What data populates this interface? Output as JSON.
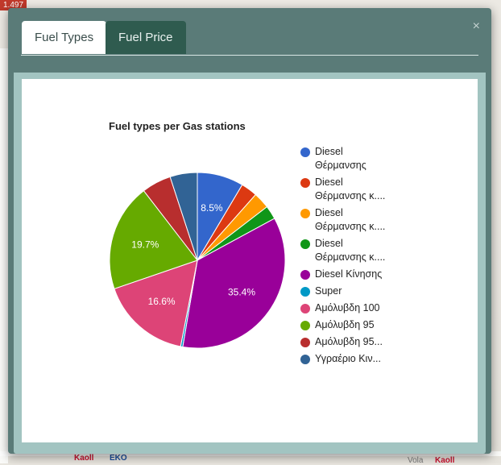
{
  "background": {
    "badge": "1.497",
    "logos": [
      "Kaoll",
      "EKO",
      "Kaoll",
      "Vola"
    ]
  },
  "modal": {
    "tabs": [
      {
        "label": "Fuel Types",
        "active": true
      },
      {
        "label": "Fuel Price",
        "active": false
      }
    ],
    "close_symbol": "×"
  },
  "chart_data": {
    "type": "pie",
    "title": "Fuel types per Gas stations",
    "legend_position": "right",
    "series": [
      {
        "name": "Diesel Θέρμανσης",
        "legend_lines": [
          "Diesel",
          "Θέρμανσης"
        ],
        "value": 8.5,
        "color": "#3366cc",
        "label": "8.5%"
      },
      {
        "name": "Diesel Θέρμανσης κ....",
        "legend_lines": [
          "Diesel",
          "Θέρμανσης κ...."
        ],
        "value": 3.0,
        "color": "#dc3912",
        "label": ""
      },
      {
        "name": "Diesel Θέρμανσης κ....",
        "legend_lines": [
          "Diesel",
          "Θέρμανσης κ...."
        ],
        "value": 3.0,
        "color": "#ff9900",
        "label": ""
      },
      {
        "name": "Diesel Θέρμανσης κ....",
        "legend_lines": [
          "Diesel",
          "Θέρμανσης κ...."
        ],
        "value": 2.5,
        "color": "#109618",
        "label": ""
      },
      {
        "name": "Diesel Κίνησης",
        "legend_lines": [
          "Diesel Κίνησης"
        ],
        "value": 35.4,
        "color": "#990099",
        "label": "35.4%"
      },
      {
        "name": "Super",
        "legend_lines": [
          "Super"
        ],
        "value": 0.4,
        "color": "#0099c6",
        "label": ""
      },
      {
        "name": "Αμόλυβδη 100",
        "legend_lines": [
          "Αμόλυβδη 100"
        ],
        "value": 16.6,
        "color": "#dd4477",
        "label": "16.6%"
      },
      {
        "name": "Αμόλυβδη 95",
        "legend_lines": [
          "Αμόλυβδη 95"
        ],
        "value": 19.7,
        "color": "#66aa00",
        "label": "19.7%"
      },
      {
        "name": "Αμόλυβδη 95...",
        "legend_lines": [
          "Αμόλυβδη 95..."
        ],
        "value": 5.4,
        "color": "#b82e2e",
        "label": ""
      },
      {
        "name": "Υγραέριο Κιν...",
        "legend_lines": [
          "Υγραέριο Κιν..."
        ],
        "value": 5.0,
        "color": "#316395",
        "label": ""
      }
    ]
  }
}
